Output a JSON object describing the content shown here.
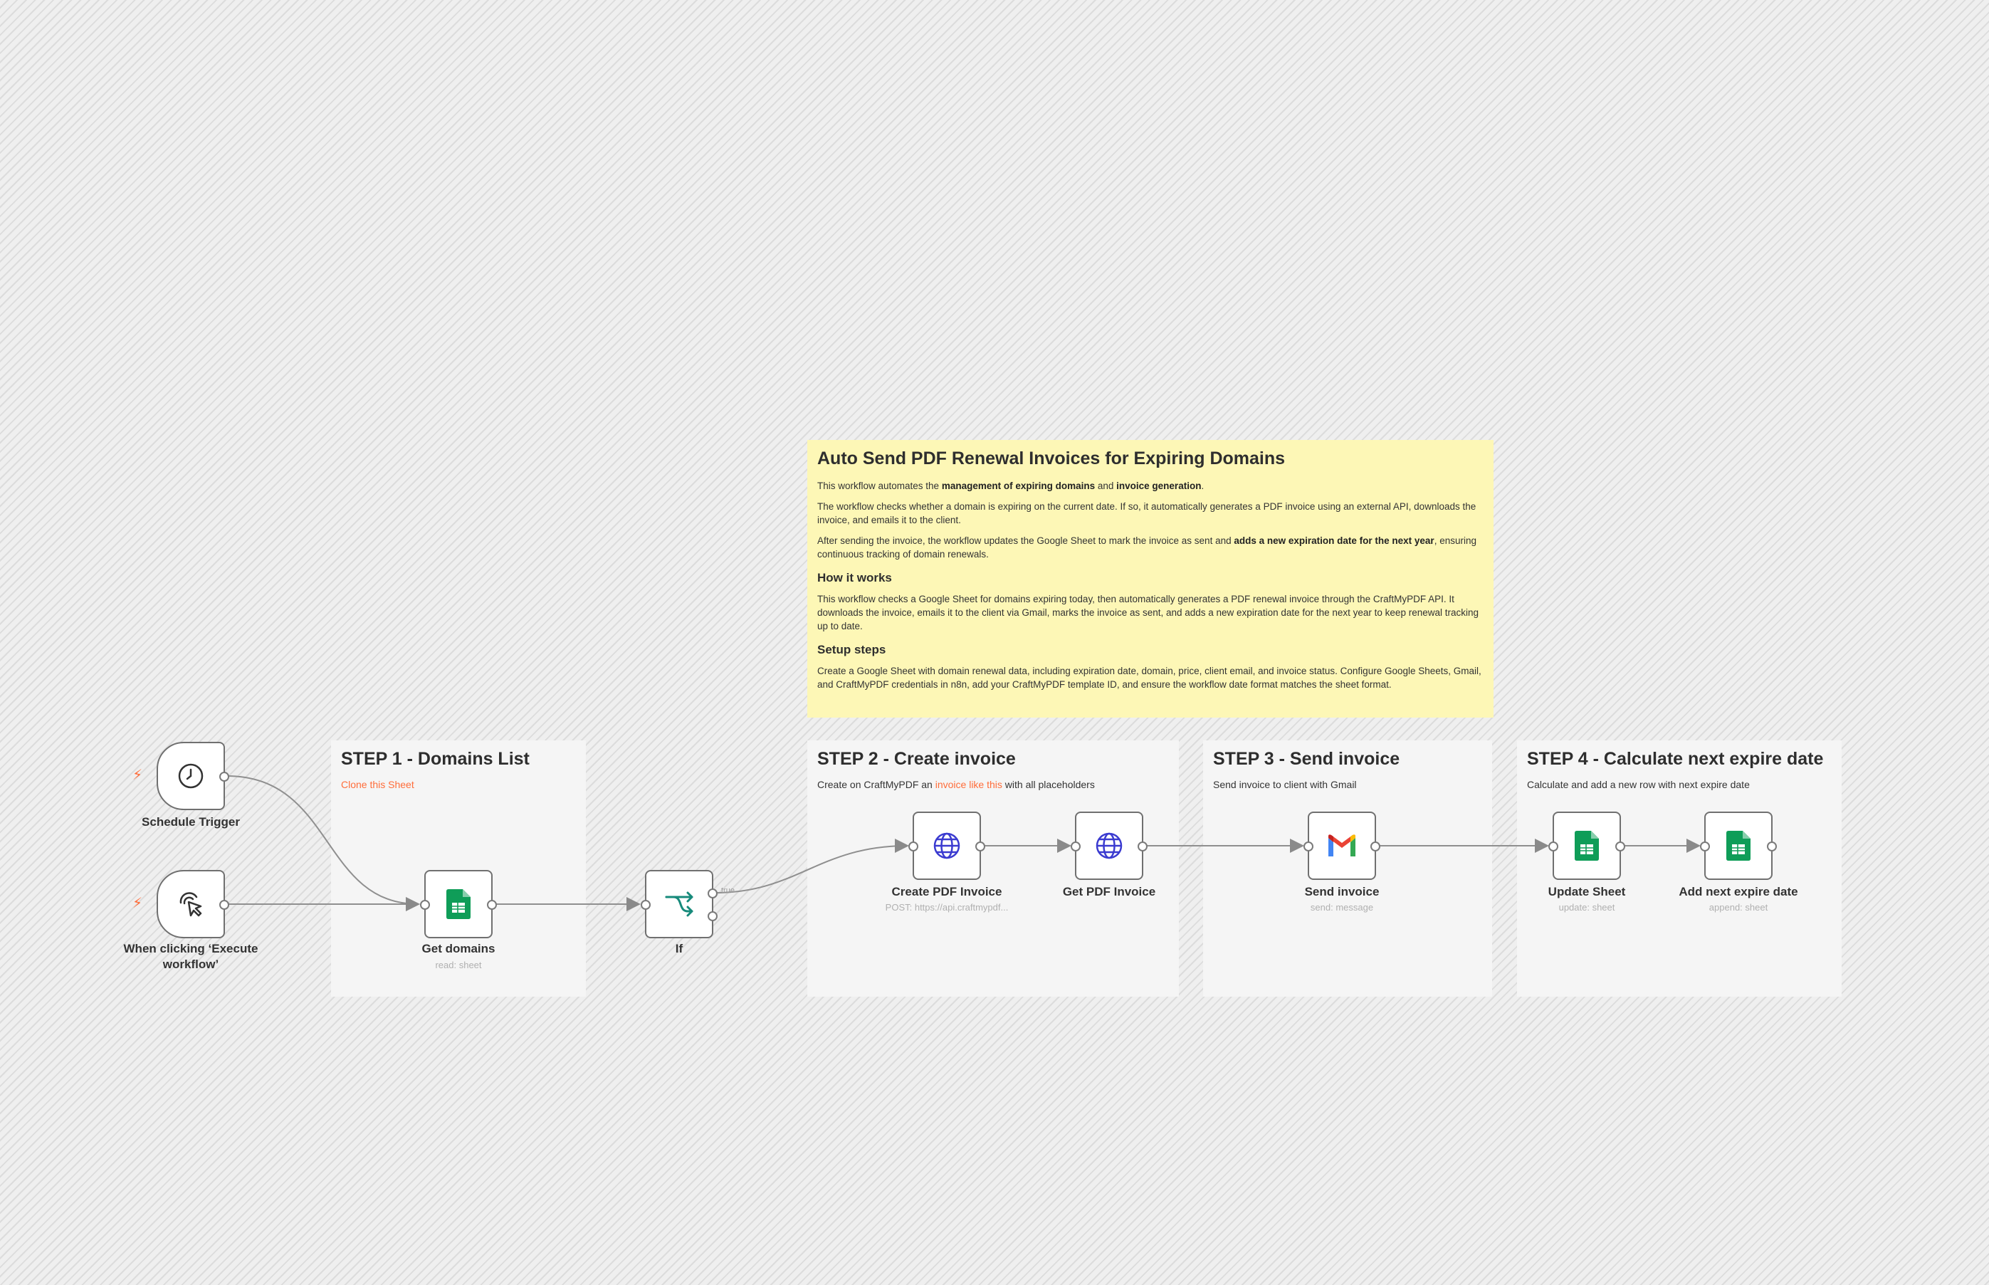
{
  "sticky_main": {
    "title": "Auto Send PDF Renewal Invoices for Expiring Domains",
    "intro_a": "This workflow automates the ",
    "intro_b": "management of expiring domains",
    "intro_c": " and ",
    "intro_d": "invoice generation",
    "intro_e": ".",
    "para2": "The workflow checks whether a domain is expiring on the current date. If so, it automatically generates a PDF invoice using an external API, downloads the invoice, and emails it to the client.",
    "para3_a": "After sending the invoice, the workflow updates the Google Sheet to mark the invoice as sent and ",
    "para3_b": "adds a new expiration date for the next year",
    "para3_c": ", ensuring continuous tracking of domain renewals.",
    "how_title": "How it works",
    "how_text": "This workflow checks a Google Sheet for domains expiring today, then automatically generates a PDF renewal invoice through the CraftMyPDF API. It downloads the invoice, emails it to the client via Gmail, marks the invoice as sent, and adds a new expiration date for the next year to keep renewal tracking up to date.",
    "setup_title": "Setup steps",
    "setup_text": "Create a Google Sheet with domain renewal data, including expiration date, domain, price, client email, and invoice status. Configure Google Sheets, Gmail, and CraftMyPDF credentials in n8n, add your CraftMyPDF template ID, and ensure the workflow date format matches the sheet format."
  },
  "step1": {
    "title": "STEP 1 - Domains List",
    "link": "Clone this Sheet"
  },
  "step2": {
    "title": "STEP 2 - Create invoice",
    "text_a": "Create on CraftMyPDF an ",
    "link": "invoice like this",
    "text_b": " with all placeholders"
  },
  "step3": {
    "title": "STEP 3 - Send invoice",
    "text": "Send invoice to client with Gmail"
  },
  "step4": {
    "title": "STEP 4 - Calculate next expire date",
    "text": "Calculate and add a new row with next expire date"
  },
  "nodes": {
    "schedule": {
      "label": "Schedule Trigger",
      "icon": "clock-icon"
    },
    "manual": {
      "label": "When clicking ‘Execute workflow’",
      "icon": "cursor-click-icon"
    },
    "get_domains": {
      "label": "Get domains",
      "sub": "read: sheet",
      "icon": "google-sheets-icon"
    },
    "if": {
      "label": "If",
      "icon": "branch-icon",
      "true_label": "true"
    },
    "create_pdf": {
      "label": "Create PDF Invoice",
      "sub": "POST: https://api.craftmypdf...",
      "icon": "globe-icon"
    },
    "get_pdf": {
      "label": "Get PDF Invoice",
      "icon": "globe-icon"
    },
    "send_invoice": {
      "label": "Send invoice",
      "sub": "send: message",
      "icon": "gmail-icon"
    },
    "update_sheet": {
      "label": "Update Sheet",
      "sub": "update: sheet",
      "icon": "google-sheets-icon"
    },
    "add_next": {
      "label": "Add next expire date",
      "sub": "append: sheet",
      "icon": "google-sheets-icon"
    }
  },
  "colors": {
    "accent": "#ff6d3a",
    "sticky_yellow": "#fdf7b6",
    "sheets_green": "#0f9d58",
    "globe_blue": "#3b3bd0",
    "branch_teal": "#178a7b"
  }
}
